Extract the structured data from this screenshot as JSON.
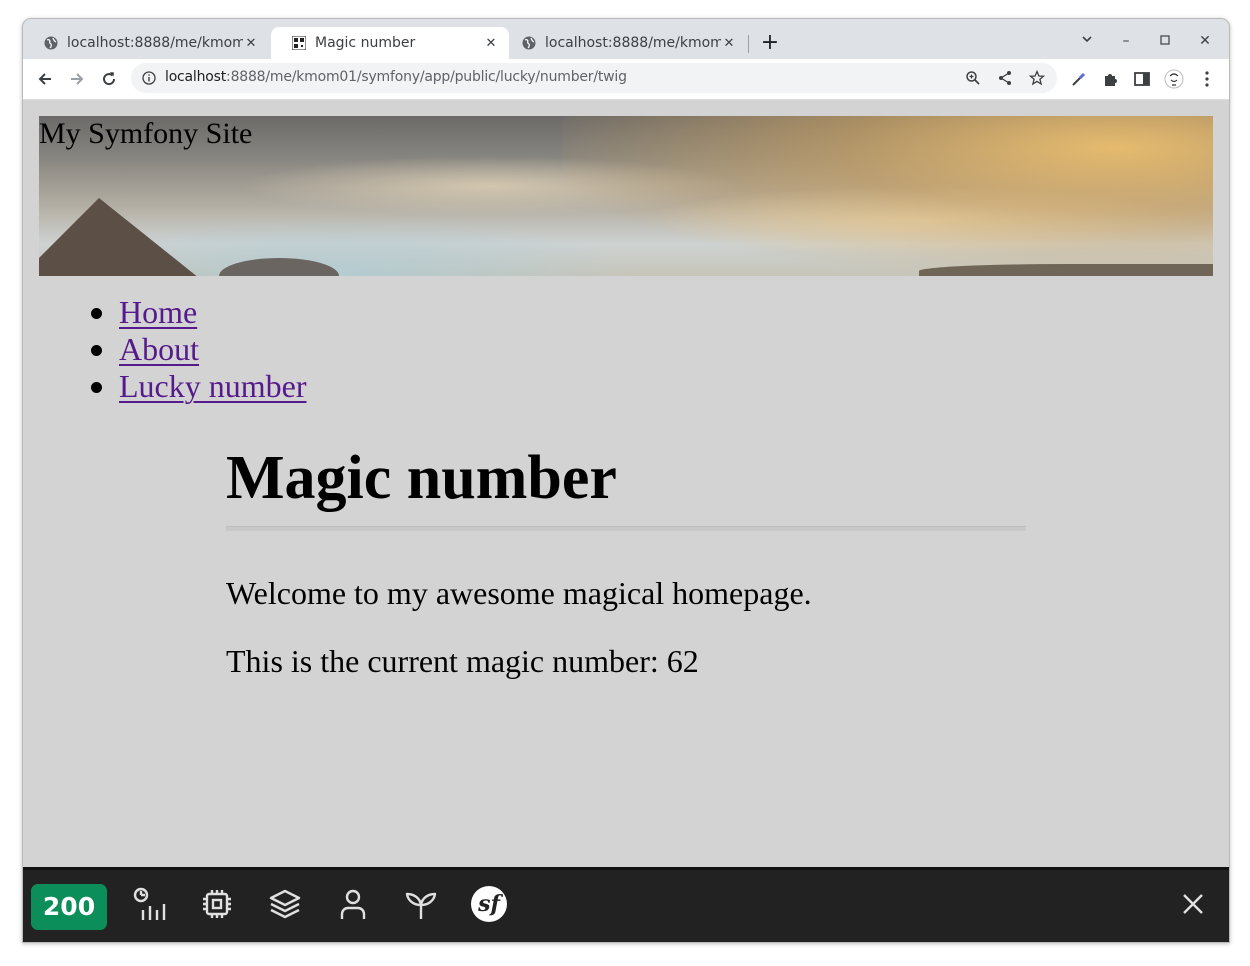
{
  "browser": {
    "tabs": [
      {
        "title": "localhost:8888/me/kmom",
        "active": false
      },
      {
        "title": "Magic number",
        "active": true
      },
      {
        "title": "localhost:8888/me/kmom",
        "active": false
      }
    ],
    "url_host": "localhost",
    "url_rest": ":8888/me/kmom01/symfony/app/public/lucky/number/twig"
  },
  "site": {
    "title": "My Symfony Site",
    "nav": [
      {
        "label": "Home"
      },
      {
        "label": "About"
      },
      {
        "label": "Lucky number"
      }
    ]
  },
  "main": {
    "heading": "Magic number",
    "welcome": "Welcome to my awesome magical homepage.",
    "magic_text": "This is the current magic number: 62"
  },
  "debugbar": {
    "status": "200",
    "status_color": "#0b8e5a",
    "icons": [
      "time-icon",
      "memory-icon",
      "layers-icon",
      "user-icon",
      "twig-icon",
      "symfony-logo-icon"
    ]
  },
  "colors": {
    "page_bg": "#d3d3d3",
    "link": "#551a8b",
    "debugbar_bg": "#222222"
  }
}
